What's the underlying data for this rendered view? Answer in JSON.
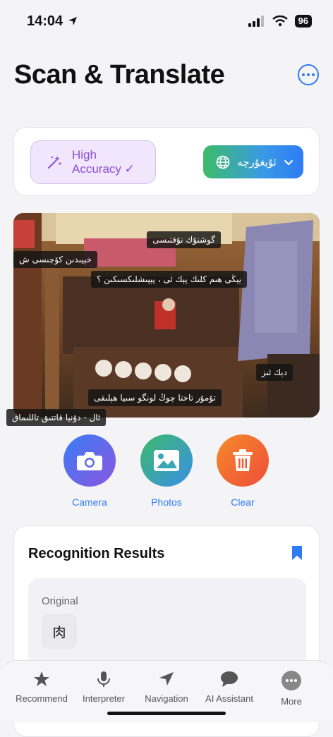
{
  "status": {
    "time": "14:04",
    "battery": "96"
  },
  "header": {
    "title": "Scan & Translate"
  },
  "options": {
    "accuracy_line1": "High",
    "accuracy_line2": "Accuracy ✓",
    "language": "ئۇيغۇرچە"
  },
  "photo_overlays": [
    "گوشنۇك نۇقتىسى",
    "خېيىدىن كۆچىسى ش",
    "يېڭى ھىم كلىك پېك ئى ، پېپىشلىكسىكىن ؟",
    "دېك ئىز",
    "تۇمۇر تاختا چوڭ لونگو سىيا ھېلىقى",
    "ئال - دۇنيا قاتتىق تاللىماق"
  ],
  "actions": {
    "camera": "Camera",
    "photos": "Photos",
    "clear": "Clear"
  },
  "results": {
    "title": "Recognition Results",
    "original_label": "Original",
    "original_text": "肉"
  },
  "tabs": [
    "Recommend",
    "Interpreter",
    "Navigation",
    "AI Assistant",
    "More"
  ],
  "colors": {
    "accent": "#2f7bf5",
    "purple": "#8a4fd6",
    "orange": "#f05a2a"
  }
}
